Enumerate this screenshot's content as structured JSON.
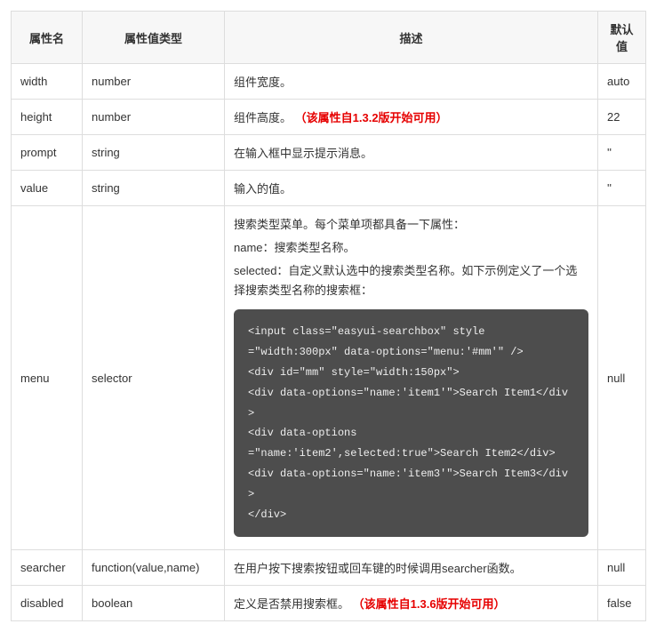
{
  "headers": {
    "name": "属性名",
    "type": "属性值类型",
    "desc": "描述",
    "def": "默认值"
  },
  "rows": [
    {
      "name": "width",
      "type": "number",
      "desc": "组件宽度。",
      "note": "",
      "def": "auto"
    },
    {
      "name": "height",
      "type": "number",
      "desc": "组件高度。",
      "note": "（该属性自1.3.2版开始可用）",
      "def": "22"
    },
    {
      "name": "prompt",
      "type": "string",
      "desc": "在输入框中显示提示消息。",
      "note": "",
      "def": "''"
    },
    {
      "name": "value",
      "type": "string",
      "desc": "输入的值。",
      "note": "",
      "def": "''"
    },
    {
      "name": "menu",
      "type": "selector",
      "desc_lines": [
        "搜索类型菜单。每个菜单项都具备一下属性：",
        "name：搜索类型名称。",
        "selected：自定义默认选中的搜索类型名称。如下示例定义了一个选择搜索类型名称的搜索框："
      ],
      "code": "<input class=\"easyui-searchbox\" style\n=\"width:300px\" data-options=\"menu:'#mm'\" />\n<div id=\"mm\" style=\"width:150px\">\n<div data-options=\"name:'item1'\">Search Item1</div>\n<div data-options\n=\"name:'item2',selected:true\">Search Item2</div>\n<div data-options=\"name:'item3'\">Search Item3</div>\n</div>",
      "def": "null"
    },
    {
      "name": "searcher",
      "type": "function(value,name)",
      "desc": "在用户按下搜索按钮或回车键的时候调用searcher函数。",
      "note": "",
      "def": "null"
    },
    {
      "name": "disabled",
      "type": "boolean",
      "desc": "定义是否禁用搜索框。",
      "note": "（该属性自1.3.6版开始可用）",
      "def": "false"
    }
  ]
}
